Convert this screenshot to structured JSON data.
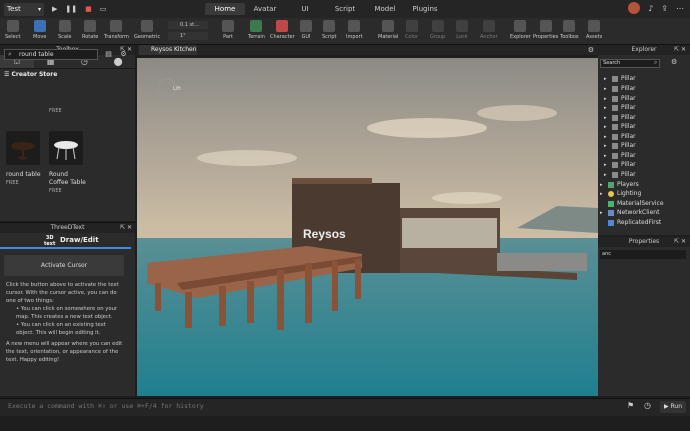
{
  "topbar": {
    "place_selector": "Test",
    "menu_tabs": [
      {
        "label": "Home"
      },
      {
        "label": "Avatar"
      },
      {
        "label": "UI"
      },
      {
        "label": "Script"
      },
      {
        "label": "Model"
      },
      {
        "label": "Plugins"
      }
    ]
  },
  "ribbon": {
    "tools": [
      "Select",
      "Move",
      "Scale",
      "Rotate",
      "Transform",
      "Geometric"
    ],
    "snap_move": "0.1 st...",
    "snap_rotate": "1°",
    "parts": [
      "Part",
      "Terrain",
      "Character",
      "GUI",
      "Script",
      "Import"
    ],
    "material": [
      "Material",
      "Color",
      "Group",
      "Lock",
      "Anchor"
    ],
    "panels": [
      "Explorer",
      "Properties",
      "Toolbox",
      "Assets"
    ]
  },
  "toolbox": {
    "title": "Toolbox",
    "store": "Creator Store",
    "search": "round table",
    "items": [
      {
        "name_line1": "round table",
        "name_line2": "",
        "price": "FREE"
      },
      {
        "name_line1": "Round",
        "name_line2": "Coffee Table",
        "price": "FREE"
      }
    ],
    "top_cutoff": "FREE"
  },
  "threed": {
    "title": "ThreeDText",
    "logo_top": "3D",
    "logo_bottom": "text",
    "heading": "Draw/Edit",
    "button": "Activate Cursor",
    "para1": "Click the button above to activate the text cursor. With the cursor active, you can do one of two things:",
    "bullet1": "• You can click on somewhere on your map. This creates a new text object.",
    "bullet2": "• You can click on an existing text object. This will begin editing it.",
    "para2": "A new menu will appear where you can edit the text, orientation, or appearance of the text. Happy editing!"
  },
  "viewport": {
    "tab": "Reysos Kitchen",
    "sign": "Reysos",
    "gizmo": "Lift"
  },
  "explorer": {
    "title": "Explorer",
    "search": "Search",
    "rows": [
      "Pillar",
      "Pillar",
      "Pillar",
      "Pillar",
      "Pillar",
      "Pillar",
      "Pillar",
      "Pillar",
      "Pillar",
      "Pillar",
      "Pillar",
      "Players",
      "Lighting",
      "MaterialService",
      "NetworkClient",
      "ReplicatedFirst"
    ]
  },
  "properties": {
    "title": "Properties",
    "filter": "anc"
  },
  "command": {
    "placeholder": "Execute a command with ⌘⇧ or use ⌘+F/4 for history",
    "run": "Run"
  },
  "colors": {
    "accent": "#3c8ce6",
    "water": "#2f8a9a",
    "sky": "#c9b89e",
    "wood": "#8a5a3c"
  }
}
